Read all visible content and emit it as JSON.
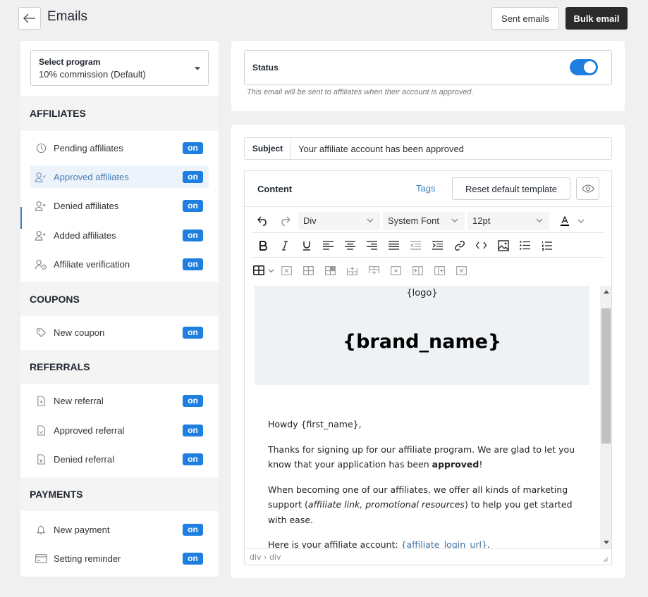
{
  "header": {
    "title": "Emails",
    "sent_emails_label": "Sent emails",
    "bulk_email_label": "Bulk email"
  },
  "sidebar": {
    "program_select": {
      "label": "Select program",
      "value": "10% commission (Default)"
    },
    "sections": [
      {
        "title": "AFFILIATES",
        "items": [
          {
            "label": "Pending affiliates",
            "icon": "clock-icon",
            "badge": "on",
            "active": false
          },
          {
            "label": "Approved affiliates",
            "icon": "user-check-icon",
            "badge": "on",
            "active": true
          },
          {
            "label": "Denied affiliates",
            "icon": "user-x-icon",
            "badge": "on",
            "active": false
          },
          {
            "label": "Added affiliates",
            "icon": "user-plus-icon",
            "badge": "on",
            "active": false
          },
          {
            "label": "Affiliate verification",
            "icon": "user-clock-icon",
            "badge": "on",
            "active": false
          }
        ]
      },
      {
        "title": "COUPONS",
        "items": [
          {
            "label": "New coupon",
            "icon": "tag-icon",
            "badge": "on",
            "active": false
          }
        ]
      },
      {
        "title": "REFERRALS",
        "items": [
          {
            "label": "New referral",
            "icon": "file-plus-icon",
            "badge": "on",
            "active": false
          },
          {
            "label": "Approved referral",
            "icon": "file-check-icon",
            "badge": "on",
            "active": false
          },
          {
            "label": "Denied referral",
            "icon": "file-x-icon",
            "badge": "on",
            "active": false
          }
        ]
      },
      {
        "title": "PAYMENTS",
        "items": [
          {
            "label": "New payment",
            "icon": "bell-icon",
            "badge": "on",
            "active": false
          },
          {
            "label": "Setting reminder",
            "icon": "credit-card-icon",
            "badge": "on",
            "active": false
          }
        ]
      }
    ]
  },
  "status_panel": {
    "label": "Status",
    "enabled": true,
    "note": "This email will be sent to affiliates when their account is approved."
  },
  "email": {
    "subject_label": "Subject",
    "subject_value": "Your affiliate account has been approved",
    "content_label": "Content",
    "tags_link": "Tags",
    "reset_button": "Reset default template",
    "toolbar": {
      "block_format": "Div",
      "font_family": "System Font",
      "font_size": "12pt"
    },
    "body": {
      "logo_placeholder": "{logo}",
      "brand_placeholder": "{brand_name}",
      "greeting": "Howdy {first_name},",
      "p1_start": "Thanks for signing up for our affiliate program. We are glad to let you know that your application has been ",
      "p1_bold": "approved",
      "p1_end": "!",
      "p2_start": "When becoming one of our affiliates, we offer all kinds of marketing support (",
      "p2_italic": "affiliate link, promotional resources",
      "p2_end": ") to help you get started with ease.",
      "p3_start": "Here is your affiliate account: ",
      "p3_link": "{affiliate_login_url}",
      "p3_end": "."
    },
    "path": "div › div"
  },
  "colors": {
    "accent": "#1e7fe0",
    "link": "#3d7fc4",
    "dark_button": "#2b2b2b",
    "active_item_bg": "#edf3fa"
  }
}
